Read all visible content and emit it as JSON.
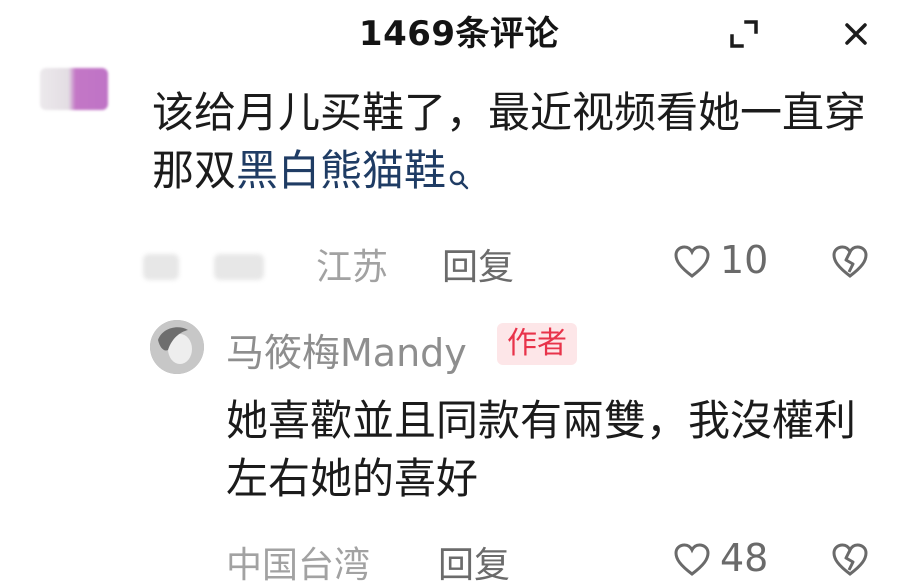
{
  "header": {
    "title": "1469条评论",
    "expand_icon": "expand-icon",
    "close_icon": "close-icon"
  },
  "comment": {
    "text_prefix": "该给月儿买鞋了，最近视频看她一直穿那双",
    "link_text": "黑白熊猫鞋",
    "search_icon": "search-icon",
    "location": "江苏",
    "reply_label": "回复",
    "like_count": "10",
    "like_icon": "heart-outline-icon",
    "dislike_icon": "broken-heart-icon"
  },
  "reply": {
    "author": "马筱梅Mandy",
    "badge": "作者",
    "text": "她喜歡並且同款有兩雙，我沒權利左右她的喜好",
    "location": "中国台湾",
    "reply_label": "回复",
    "like_count": "48",
    "like_icon": "heart-outline-icon",
    "dislike_icon": "broken-heart-icon"
  }
}
